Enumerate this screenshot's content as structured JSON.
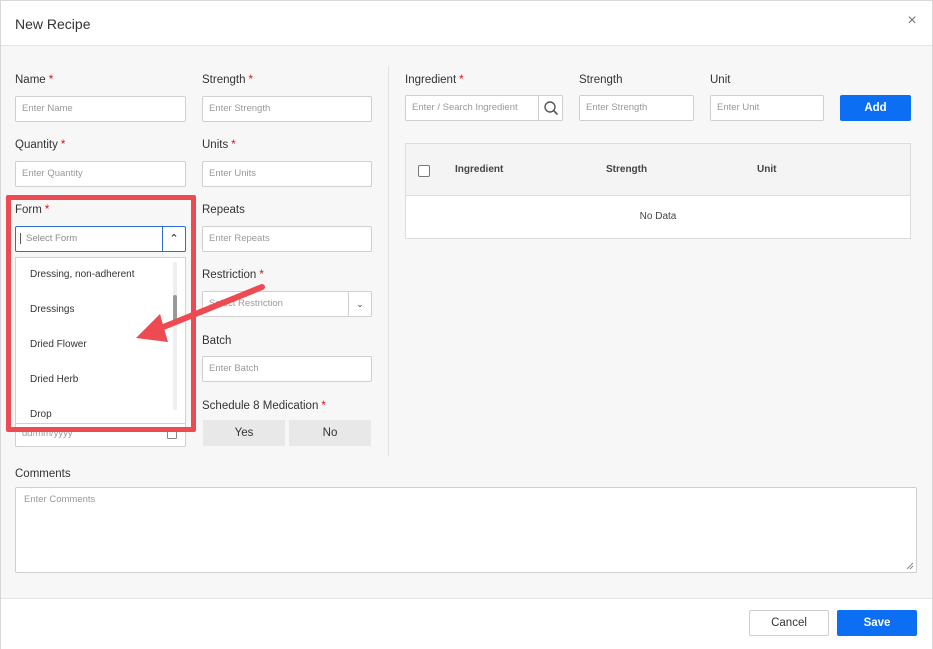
{
  "dialog": {
    "title": "New Recipe",
    "close_glyph": "×"
  },
  "form": {
    "name": {
      "label": "Name",
      "required": "*",
      "placeholder": "Enter Name"
    },
    "strength": {
      "label": "Strength",
      "required": "*",
      "placeholder": "Enter Strength"
    },
    "quantity": {
      "label": "Quantity",
      "required": "*",
      "placeholder": "Enter Quantity"
    },
    "units": {
      "label": "Units",
      "required": "*",
      "placeholder": "Enter Units"
    },
    "form": {
      "label": "Form",
      "required": "*",
      "placeholder": "Select Form",
      "options": [
        "Dressing, non-adherent",
        "Dressings",
        "Dried Flower",
        "Dried Herb",
        "Drop"
      ]
    },
    "repeats": {
      "label": "Repeats",
      "placeholder": "Enter Repeats"
    },
    "restriction": {
      "label": "Restriction",
      "required": "*",
      "placeholder": "Select Restriction"
    },
    "batch": {
      "label": "Batch",
      "placeholder": "Enter Batch"
    },
    "date": {
      "placeholder": "dd/mm/yyyy"
    },
    "schedule8": {
      "label": "Schedule 8 Medication",
      "required": "*",
      "yes": "Yes",
      "no": "No"
    },
    "comments": {
      "label": "Comments",
      "placeholder": "Enter Comments"
    }
  },
  "ingredients": {
    "ingredient": {
      "label": "Ingredient",
      "required": "*",
      "placeholder": "Enter / Search Ingredient"
    },
    "strength": {
      "label": "Strength",
      "placeholder": "Enter Strength"
    },
    "unit": {
      "label": "Unit",
      "placeholder": "Enter Unit"
    },
    "add_label": "Add",
    "table": {
      "columns": [
        "Ingredient",
        "Strength",
        "Unit"
      ],
      "empty_text": "No Data"
    }
  },
  "footer": {
    "cancel_label": "Cancel",
    "save_label": "Save"
  },
  "colors": {
    "primary": "#0c6ef2",
    "annotation": "#ee4a52",
    "required": "#dd1111"
  }
}
